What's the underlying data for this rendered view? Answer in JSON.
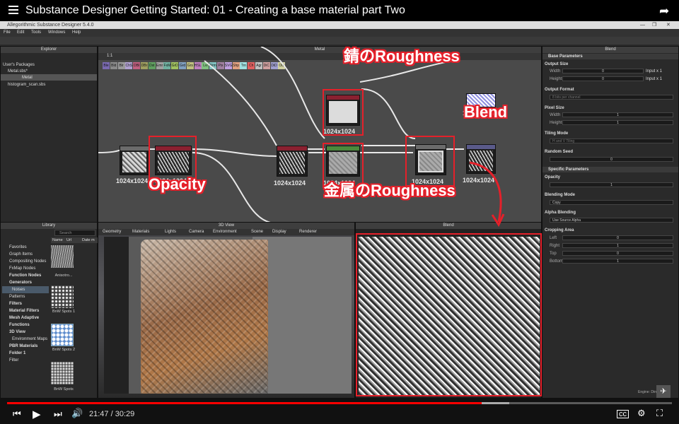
{
  "player": {
    "video_title": "Substance Designer Getting Started: 01 - Creating a base material part Two",
    "time_current": "21:47",
    "time_separator": " / ",
    "time_total": "30:29",
    "progress_fraction": 0.714,
    "buffered_fraction": 0.755,
    "share_icon": "share-arrow-icon",
    "accent_color": "#ff0000"
  },
  "app": {
    "window_title": "Allegorithmic Substance Designer 5.4.0",
    "window_buttons": [
      "—",
      "❐",
      "✕"
    ],
    "menu": [
      "File",
      "Edit",
      "Tools",
      "Windows",
      "Help"
    ]
  },
  "explorer": {
    "title": "Explorer",
    "root": "User's Packages",
    "items": [
      "Metal.sbs*",
      "Metal",
      "histogram_scan.sbs"
    ]
  },
  "graph": {
    "title": "Metal",
    "zoom": "1:1",
    "chips": [
      "Ble",
      "Bld",
      "Blr",
      "ChS",
      "DBI",
      "DBr",
      "Dst",
      "Emr",
      "FxM",
      "GrD",
      "Grd",
      "Grs",
      "HSL",
      "Lvl",
      "Nrm",
      "Pix",
      "SVG",
      "Shp",
      "Trn",
      "Ch",
      "Agr",
      "DiC",
      "DiD",
      "Out"
    ],
    "nodes": [
      {
        "label": "1024x1024"
      },
      {
        "label": "1024x1024"
      },
      {
        "label": "1024x1024"
      },
      {
        "label": "1024x1024"
      },
      {
        "label": "1024x1024"
      },
      {
        "label": "1024x1024"
      },
      {
        "label": "1024x1024"
      },
      {
        "label": "1024x1024"
      }
    ]
  },
  "annotations": {
    "rust_roughness": "錆のRoughness",
    "blend": "Blend",
    "opacity": "Opacity",
    "metal_roughness": "金属のRoughness"
  },
  "library": {
    "title": "Library",
    "search_placeholder": "Search",
    "columns": [
      "Name",
      "Url",
      "Date m"
    ],
    "categories": [
      "Favorites",
      "Graph Items",
      "Compositing Nodes",
      "FxMap Nodes",
      "Function Nodes",
      "Generators",
      "Noises",
      "Patterns",
      "Filters",
      "Material Filters",
      "Mesh Adaptive",
      "Functions",
      "3D View",
      "Environment Maps",
      "PBR Materials",
      "Folder 1",
      "Filter"
    ],
    "thumbs": [
      "Anisotro...",
      "BnW Spots 1",
      "BnW Spots 2",
      "BnW Spots"
    ]
  },
  "view3d": {
    "title": "3D View",
    "menu": [
      "Geometry",
      "Materials",
      "Lights",
      "Camera",
      "Environment",
      "Scene",
      "Display",
      "Renderer"
    ]
  },
  "blend_view": {
    "title": "Blend"
  },
  "properties": {
    "title": "Blend",
    "base_header": "Base Parameters",
    "output_size": "Output Size",
    "width": "Width",
    "width_value": "0",
    "width_mode": "Input x 1",
    "height": "Height",
    "height_value": "0",
    "height_mode": "Input x 1",
    "output_format": "Output Format",
    "output_format_value": "8 bits per channel",
    "pixel_size": "Pixel Size",
    "px_width": "Width",
    "px_width_value": "1",
    "px_height": "Height",
    "px_height_value": "1",
    "tiling_mode": "Tiling Mode",
    "tiling_value": "H and V Tiling",
    "random_seed": "Random Seed",
    "random_seed_value": "0",
    "specific_header": "Specific Parameters",
    "opacity": "Opacity",
    "opacity_value": "1",
    "blending_mode": "Blending Mode",
    "blending_mode_value": "Copy",
    "alpha_blending": "Alpha Blending",
    "alpha_blending_value": "Use Source Alpha",
    "cropping_area": "Cropping Area",
    "left": "Left",
    "left_value": "0",
    "right": "Right",
    "right_value": "1",
    "top": "Top",
    "top_value": "0",
    "bottom": "Bottom",
    "bottom_value": "1",
    "engine": "Engine: Direct3D 10"
  }
}
